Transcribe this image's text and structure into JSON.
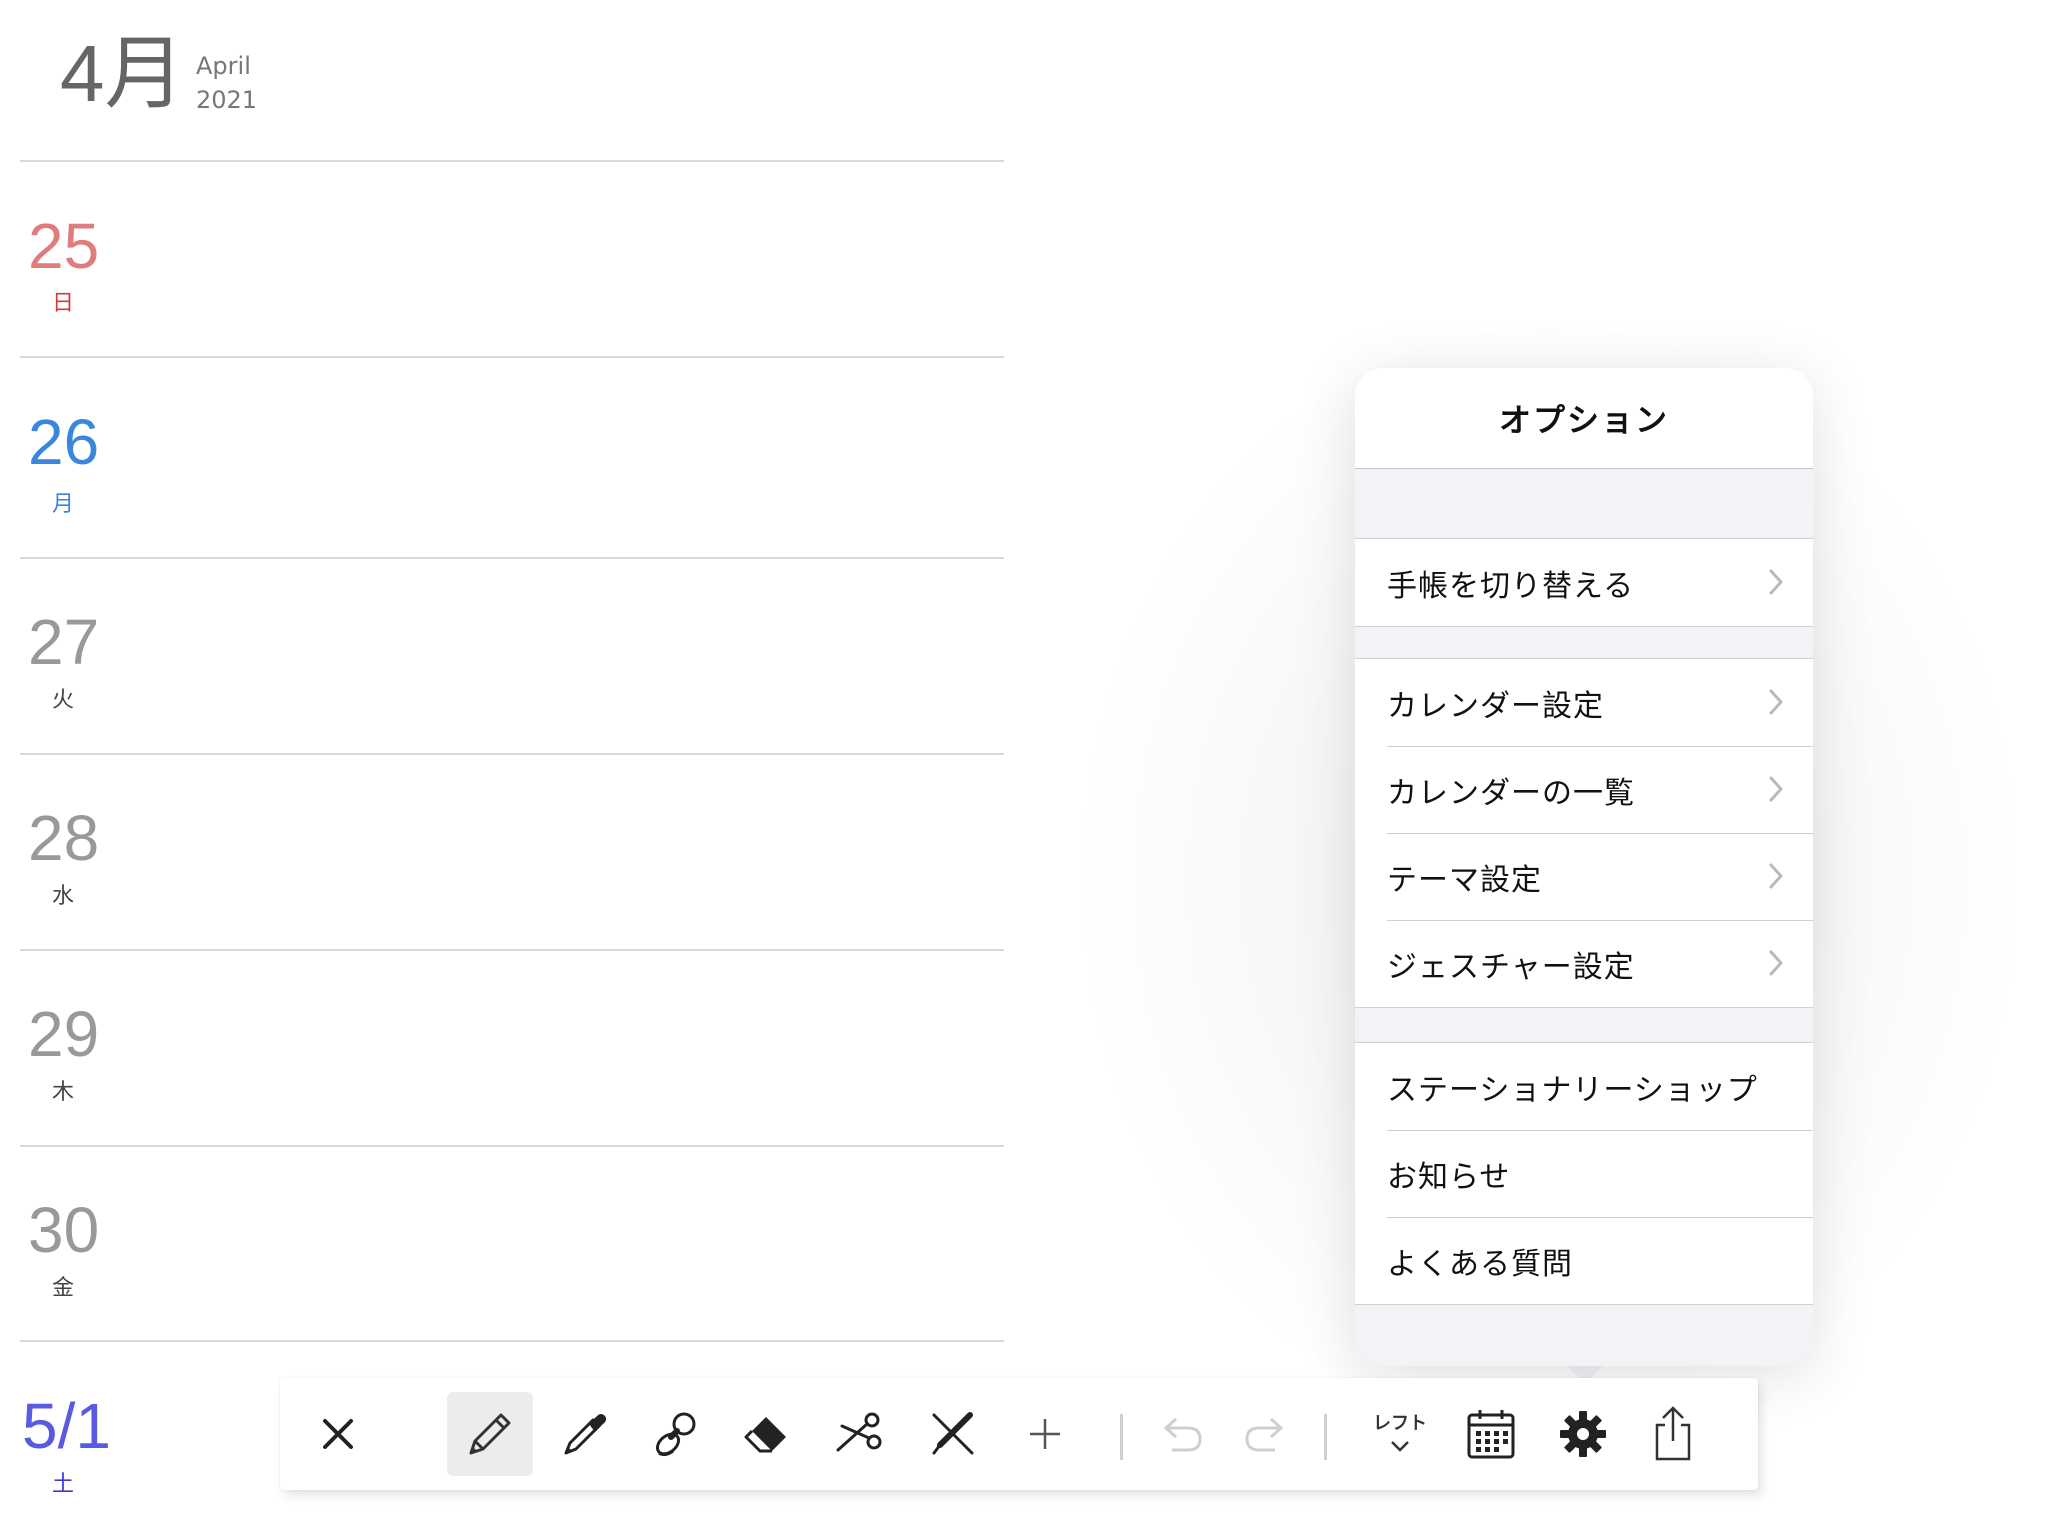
{
  "header": {
    "month": "4月",
    "month_english": "April",
    "year": "2021"
  },
  "days": [
    {
      "num": "25",
      "weekday": "日",
      "color": "#e07c7c",
      "wk_color": "#d23b3b"
    },
    {
      "num": "26",
      "weekday": "月",
      "color": "#3a86de",
      "wk_color": "#3a86de"
    },
    {
      "num": "27",
      "weekday": "火",
      "color": "#999999",
      "wk_color": "#444444"
    },
    {
      "num": "28",
      "weekday": "水",
      "color": "#999999",
      "wk_color": "#444444"
    },
    {
      "num": "29",
      "weekday": "木",
      "color": "#999999",
      "wk_color": "#444444"
    },
    {
      "num": "30",
      "weekday": "金",
      "color": "#999999",
      "wk_color": "#444444"
    },
    {
      "num": "5/1",
      "weekday": "土",
      "color": "#5a5ae0",
      "wk_color": "#3b3bd8"
    }
  ],
  "options": {
    "title": "オプション",
    "switch_notebook": "手帳を切り替える",
    "calendar_settings": "カレンダー設定",
    "calendar_list": "カレンダーの一覧",
    "theme_settings": "テーマ設定",
    "gesture_settings": "ジェスチャー設定",
    "stationery_shop": "ステーショナリーショップ",
    "notices": "お知らせ",
    "faq": "よくある質問"
  },
  "toolbar": {
    "layout_label": "レフト",
    "icons": [
      "close-icon",
      "pencil-icon",
      "pen-icon",
      "stamp-icon",
      "eraser-icon",
      "scissors-icon",
      "ruler-pen-icon",
      "plus-icon",
      "undo-icon",
      "redo-icon",
      "layout-toggle",
      "calendar-icon",
      "gear-icon",
      "share-icon"
    ],
    "active_tool": "pencil-icon"
  }
}
